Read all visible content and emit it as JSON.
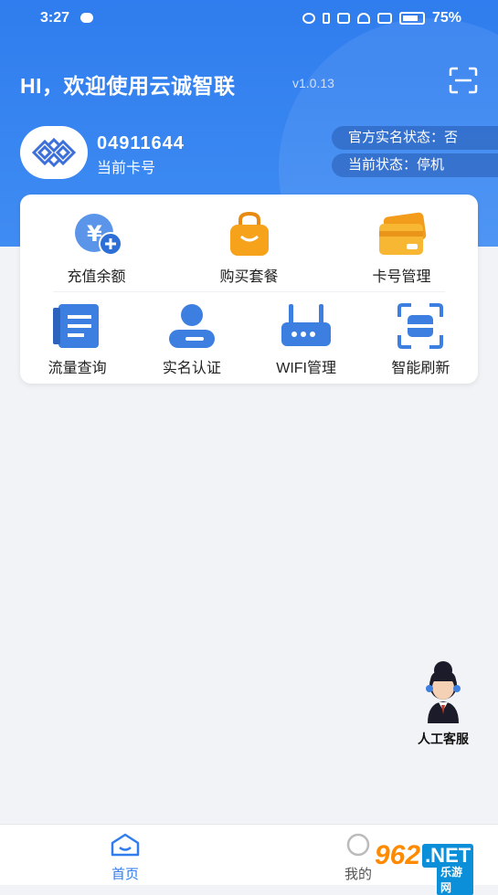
{
  "status_bar": {
    "time": "3:27",
    "battery": "75%"
  },
  "header": {
    "title": "HI，欢迎使用云诚智联",
    "version": "v1.0.13",
    "card_number": "04911644",
    "card_label": "当前卡号",
    "realname_status": "官方实名状态：否",
    "current_status": "当前状态：停机"
  },
  "menu": [
    {
      "label": "充值余额",
      "icon": "yen-recharge-icon"
    },
    {
      "label": "购买套餐",
      "icon": "shopping-bag-icon"
    },
    {
      "label": "卡号管理",
      "icon": "card-icon"
    },
    {
      "label": "流量查询",
      "icon": "document-icon"
    },
    {
      "label": "实名认证",
      "icon": "user-icon"
    },
    {
      "label": "WIFI管理",
      "icon": "router-icon"
    },
    {
      "label": "智能刷新",
      "icon": "scan-refresh-icon"
    }
  ],
  "customer_service": {
    "label": "人工客服"
  },
  "tabbar": {
    "home": "首页",
    "mine": "我的"
  },
  "watermark": {
    "brand": "962",
    "net": ".NET",
    "sub": "乐游网"
  },
  "colors": {
    "primary": "#2f7dee",
    "orange": "#f7a21b",
    "icon_blue": "#3d7fe0"
  }
}
